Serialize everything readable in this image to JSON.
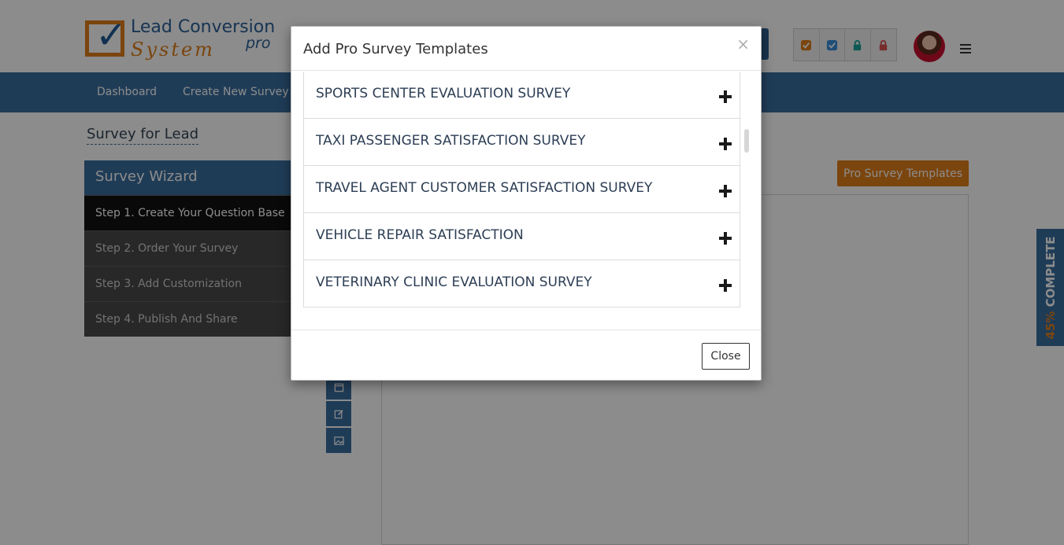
{
  "header": {
    "logo_line1": "Lead Conversion",
    "logo_line2": "System",
    "logo_pro": "pro"
  },
  "status_icons": [
    {
      "name": "check-orange-icon",
      "color": "#e07f1a"
    },
    {
      "name": "check-blue-icon",
      "color": "#3a8fd9"
    },
    {
      "name": "lock-teal-icon",
      "color": "#1aa39a"
    },
    {
      "name": "lock-red-icon",
      "color": "#d9534f"
    }
  ],
  "nav": {
    "items": [
      "Dashboard",
      "Create New Survey"
    ]
  },
  "page": {
    "title": "Survey for Lead",
    "pro_templates_button": "Pro Survey Templates"
  },
  "wizard": {
    "title": "Survey Wizard",
    "steps": [
      "Step 1. Create Your Question Base",
      "Step 2. Order Your Survey",
      "Step 3. Add Customization",
      "Step 4. Publish And Share"
    ],
    "active_step": 0
  },
  "progress": {
    "percent": "45%",
    "label": " COMPLETE"
  },
  "modal": {
    "title": "Add Pro Survey Templates",
    "close_x": "×",
    "close_button": "Close",
    "templates": [
      "SPORTS CENTER EVALUATION SURVEY",
      "TAXI PASSENGER SATISFACTION SURVEY",
      "TRAVEL AGENT CUSTOMER SATISFACTION SURVEY",
      "VEHICLE REPAIR SATISFACTION",
      "VETERINARY CLINIC EVALUATION SURVEY"
    ]
  },
  "colors": {
    "brand_blue": "#3a6e9f",
    "brand_orange": "#e07f1a"
  }
}
